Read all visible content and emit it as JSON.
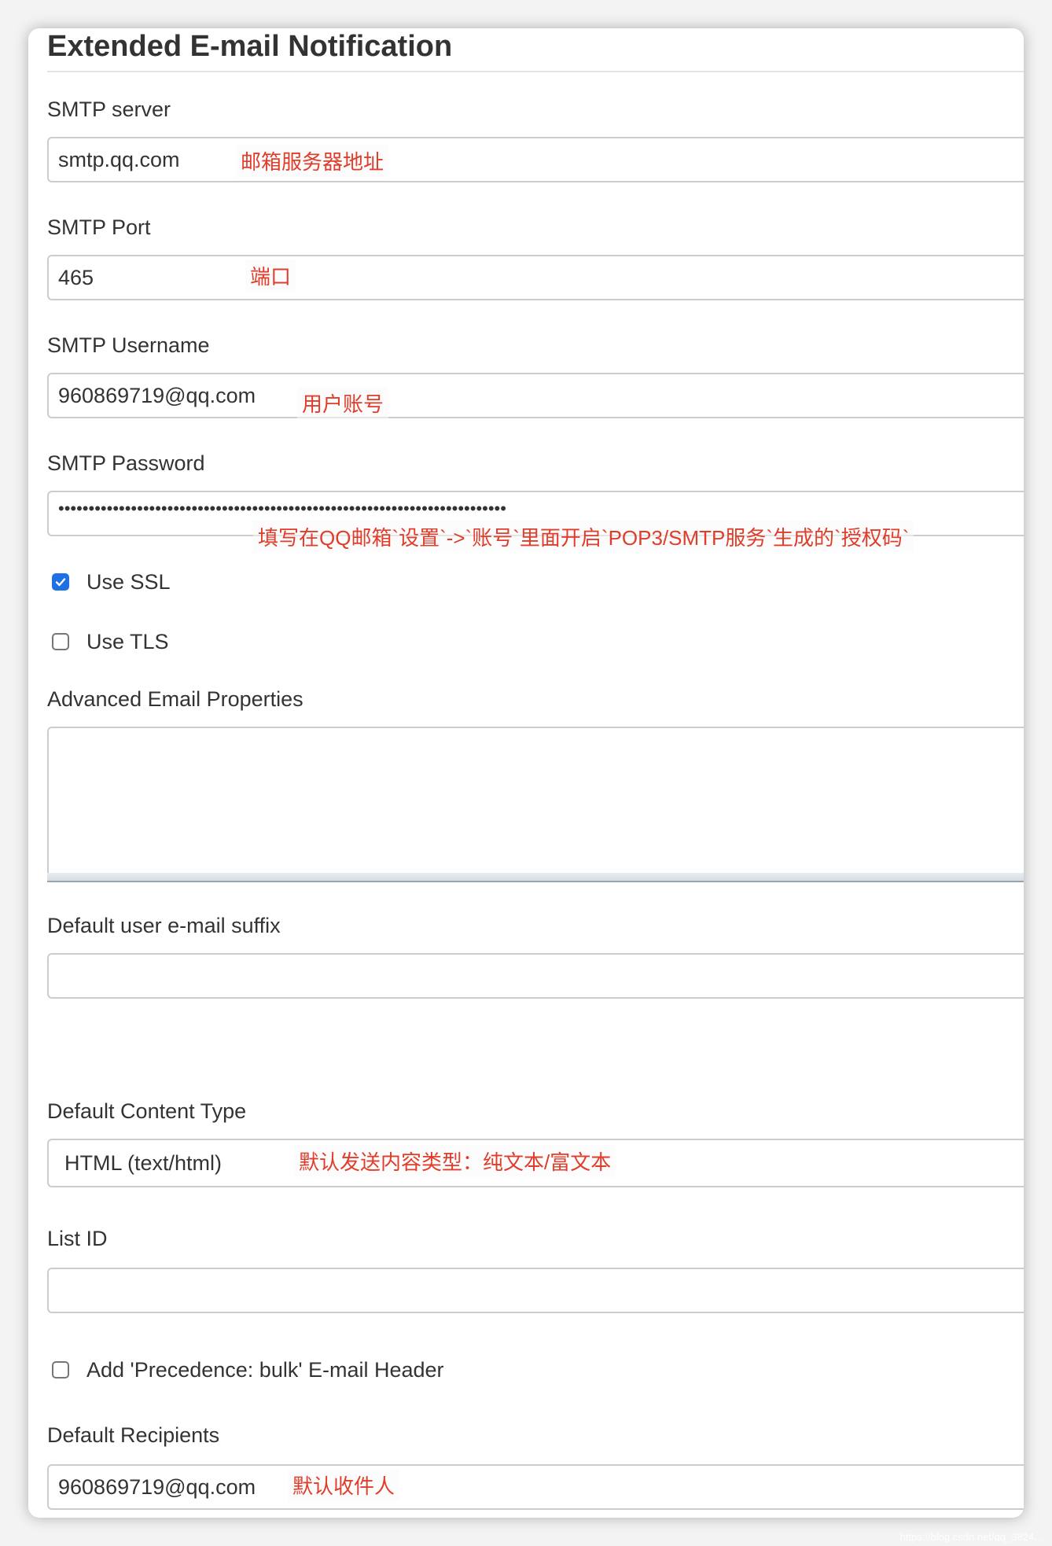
{
  "section": {
    "title": "Extended E-mail Notification"
  },
  "smtp_server": {
    "label": "SMTP server",
    "value": "smtp.qq.com",
    "annotation": "邮箱服务器地址"
  },
  "smtp_port": {
    "label": "SMTP Port",
    "value": "465",
    "annotation": "端口"
  },
  "smtp_username": {
    "label": "SMTP Username",
    "value": "960869719@qq.com",
    "annotation": "用户账号"
  },
  "smtp_password": {
    "label": "SMTP Password",
    "masked_value": "••••••••••••••••••••••••••••••••••••••••••••••••••••••••••••••••••••••••••",
    "annotation": "填写在QQ邮箱`设置`->`账号`里面开启`POP3/SMTP服务`生成的`授权码`"
  },
  "use_ssl": {
    "label": "Use SSL",
    "checked": true
  },
  "use_tls": {
    "label": "Use TLS",
    "checked": false
  },
  "advanced_properties": {
    "label": "Advanced Email Properties",
    "value": ""
  },
  "default_suffix": {
    "label": "Default user e-mail suffix",
    "value": ""
  },
  "default_content_type": {
    "label": "Default Content Type",
    "selected": "HTML (text/html)",
    "annotation": "默认发送内容类型：纯文本/富文本"
  },
  "list_id": {
    "label": "List ID",
    "value": ""
  },
  "precedence_bulk": {
    "label": "Add 'Precedence: bulk' E-mail Header",
    "checked": false
  },
  "default_recipients": {
    "label": "Default Recipients",
    "value": "960869719@qq.com",
    "annotation": "默认收件人"
  },
  "watermark": "https://blog.csdn.net/qq_3824..."
}
